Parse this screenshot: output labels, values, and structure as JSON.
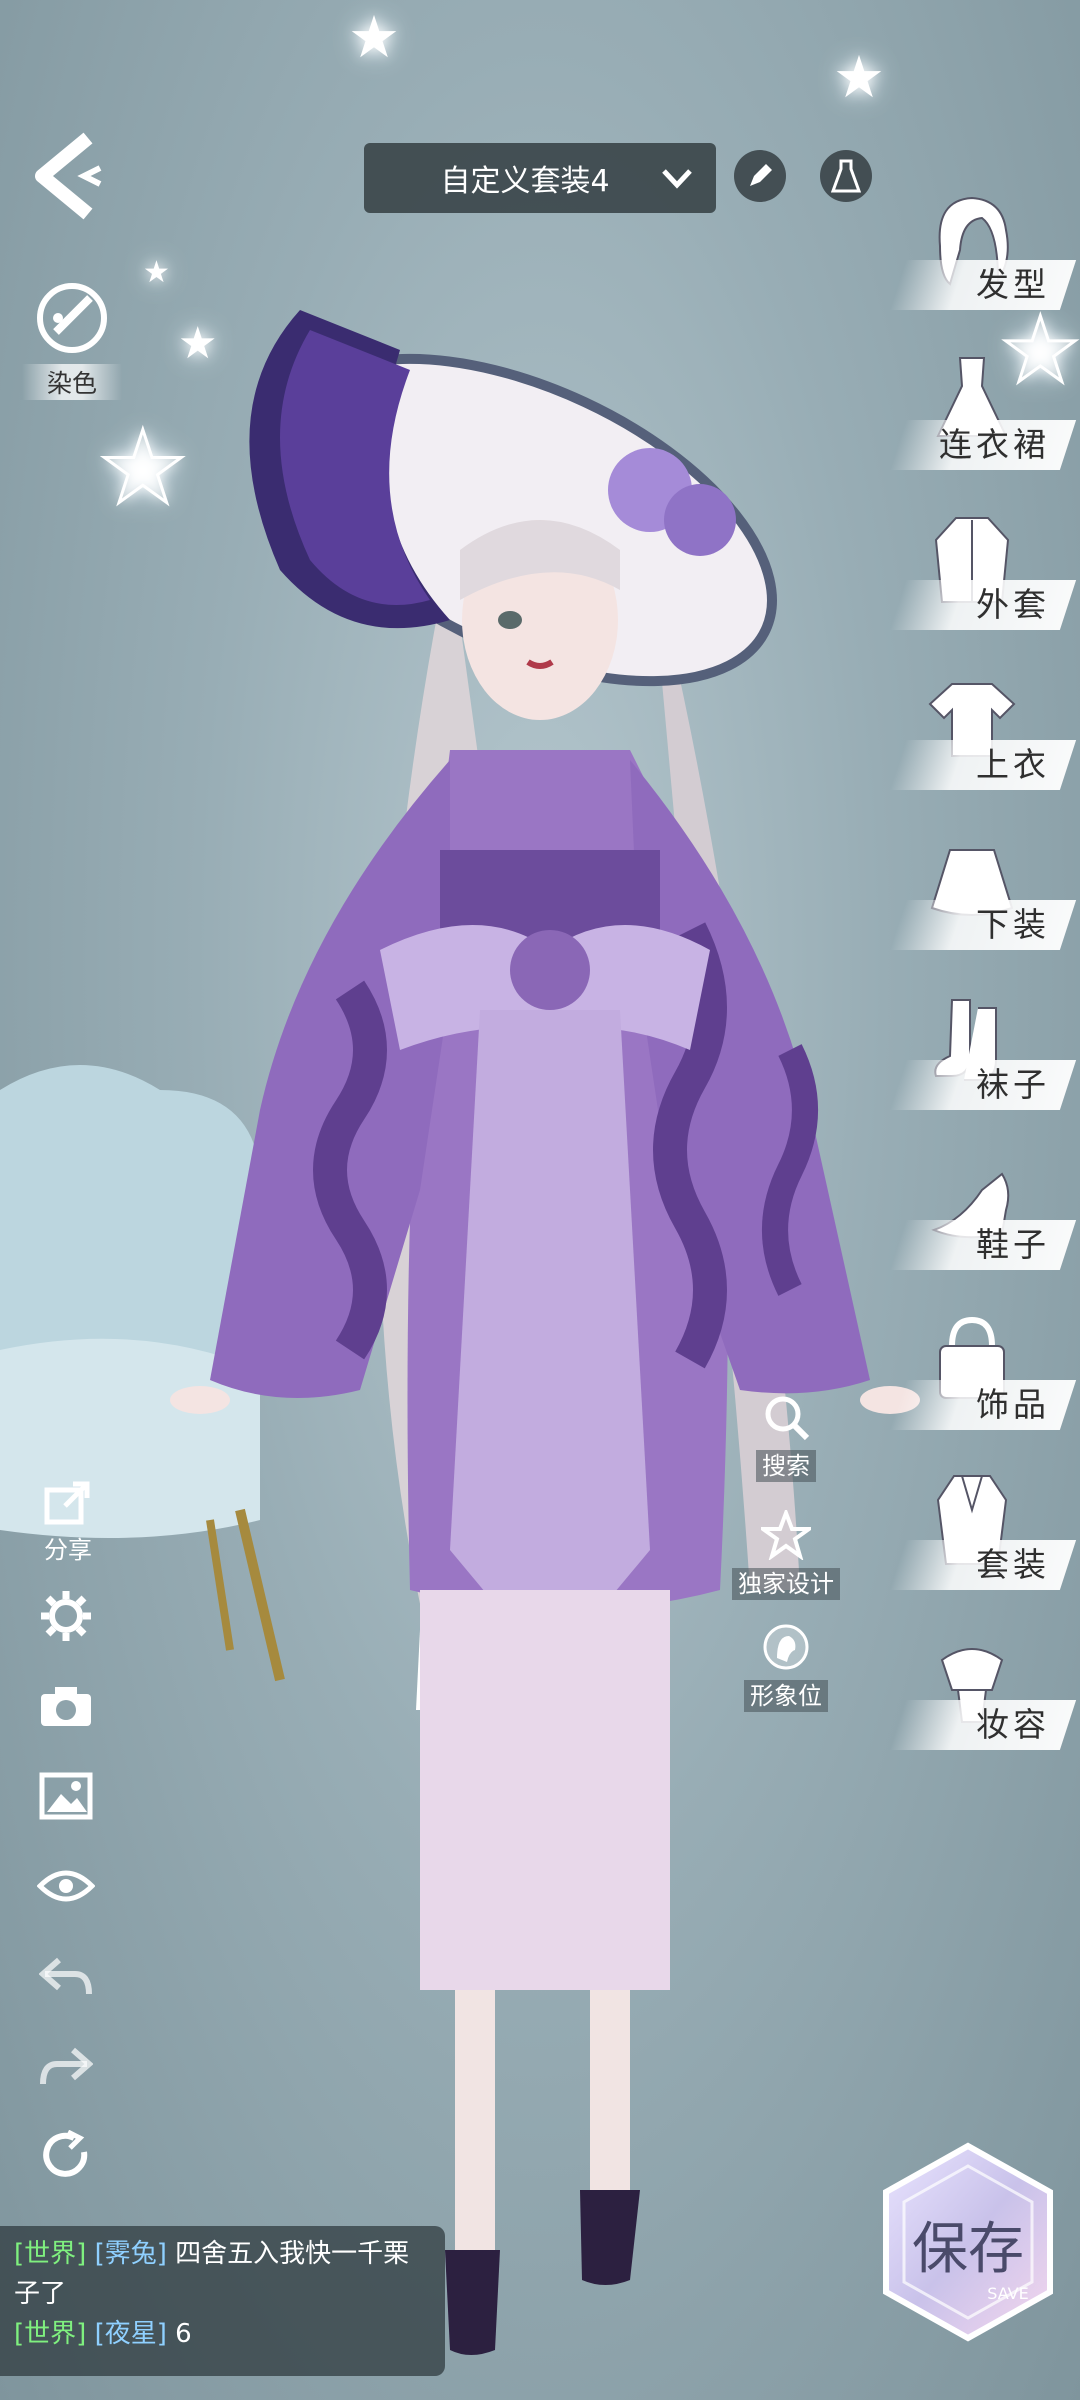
{
  "outfit_select": {
    "label": "自定义套装4"
  },
  "dye": {
    "label": "染色"
  },
  "share": {
    "label": "分享"
  },
  "categories": [
    {
      "label": "发型",
      "icon": "hair-icon"
    },
    {
      "label": "连衣裙",
      "icon": "dress-icon"
    },
    {
      "label": "外套",
      "icon": "coat-icon"
    },
    {
      "label": "上衣",
      "icon": "top-icon"
    },
    {
      "label": "下装",
      "icon": "skirt-icon"
    },
    {
      "label": "袜子",
      "icon": "socks-icon"
    },
    {
      "label": "鞋子",
      "icon": "shoe-icon"
    },
    {
      "label": "饰品",
      "icon": "bag-icon"
    },
    {
      "label": "套装",
      "icon": "suit-icon"
    },
    {
      "label": "妆容",
      "icon": "makeup-icon"
    }
  ],
  "middle_buttons": [
    {
      "label": "搜索",
      "icon": "search-icon"
    },
    {
      "label": "独家设计",
      "icon": "star-icon"
    },
    {
      "label": "形象位",
      "icon": "portrait-icon"
    }
  ],
  "chat": {
    "messages": [
      {
        "channel": "[世界]",
        "name": "[霁兔]",
        "text": "四舍五入我快一千栗子了"
      },
      {
        "channel": "[世界]",
        "name": "[夜星]",
        "text": "6"
      }
    ]
  },
  "save": {
    "label": "保存",
    "sublabel": "SAVE"
  },
  "colors": {
    "background": "#98adb5",
    "kimono": "#9a76c4",
    "chat_channel": "#7ff07f",
    "chat_name": "#8fd0ff"
  }
}
